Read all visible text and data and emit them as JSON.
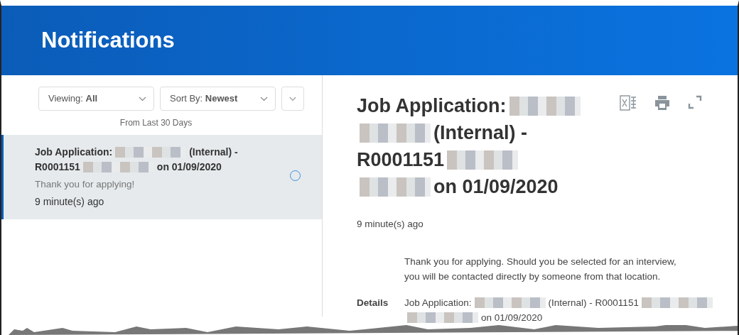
{
  "header": {
    "title": "Notifications"
  },
  "filters": [
    {
      "label": "Viewing:",
      "value": "All"
    },
    {
      "label": "Sort By:",
      "value": "Newest"
    }
  ],
  "range_note": "From Last 30 Days",
  "notifications": [
    {
      "selected": true,
      "unread": true,
      "title_lines": [
        [
          {
            "kind": "text",
            "text": "Job Application:"
          },
          {
            "kind": "redacted"
          },
          {
            "kind": "text",
            "text": "(Internal) -"
          }
        ],
        [
          {
            "kind": "text",
            "text": "R0001151"
          },
          {
            "kind": "redacted"
          },
          {
            "kind": "text",
            "text": "on 01/09/2020"
          }
        ]
      ],
      "message": "Thank you for applying!",
      "time": "9 minute(s) ago"
    }
  ],
  "detail": {
    "title_lines": [
      [
        {
          "kind": "text",
          "text": "Job Application:"
        },
        {
          "kind": "redacted"
        }
      ],
      [
        {
          "kind": "redacted"
        },
        {
          "kind": "text",
          "text": "(Internal) -"
        }
      ],
      [
        {
          "kind": "text",
          "text": "R0001151"
        },
        {
          "kind": "redacted"
        }
      ],
      [
        {
          "kind": "redacted"
        },
        {
          "kind": "text",
          "text": "on 01/09/2020"
        }
      ]
    ],
    "time": "9 minute(s) ago",
    "message_lines": [
      "Thank you for applying. Should you be selected for an interview,",
      "you will be contacted directly by someone from that location."
    ],
    "details_label": "Details",
    "details_lines": [
      [
        {
          "kind": "text",
          "text": "Job Application:"
        },
        {
          "kind": "redacted"
        },
        {
          "kind": "text",
          "text": "(Internal) - R0001151"
        },
        {
          "kind": "redacted"
        }
      ],
      [
        {
          "kind": "redacted"
        },
        {
          "kind": "text",
          "text": "on 01/09/2020"
        }
      ]
    ]
  }
}
